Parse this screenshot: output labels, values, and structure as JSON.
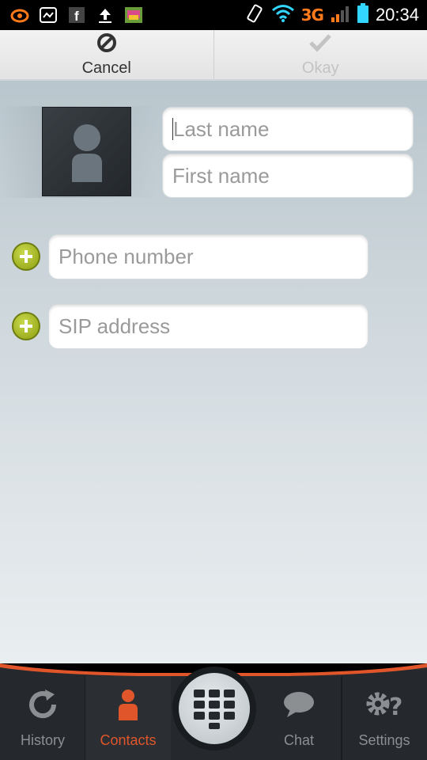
{
  "status_bar": {
    "network": "3G",
    "time": "20:34",
    "icons": [
      "app-swirl-icon",
      "gallery-icon",
      "facebook-icon",
      "upload-icon",
      "app-thumbnail-icon",
      "rotate-icon",
      "wifi-icon",
      "signal-icon",
      "battery-icon"
    ]
  },
  "action_bar": {
    "cancel_label": "Cancel",
    "okay_label": "Okay"
  },
  "form": {
    "last_name_placeholder": "Last name",
    "first_name_placeholder": "First name",
    "phone_placeholder": "Phone number",
    "sip_placeholder": "SIP address"
  },
  "tabs": [
    {
      "label": "History",
      "icon": "history-icon",
      "active": false
    },
    {
      "label": "Contacts",
      "icon": "contacts-icon",
      "active": true
    },
    {
      "label": "Chat",
      "icon": "chat-icon",
      "active": false
    },
    {
      "label": "Settings",
      "icon": "settings-icon",
      "active": false
    }
  ],
  "colors": {
    "accent": "#e0562a",
    "add_button": "#9fb21a",
    "bar_bg": "#25292d"
  }
}
